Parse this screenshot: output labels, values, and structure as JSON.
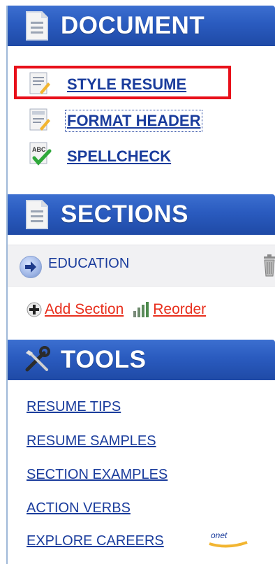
{
  "document": {
    "title": "DOCUMENT",
    "items": [
      {
        "label": "STYLE RESUME",
        "icon": "style-resume-icon"
      },
      {
        "label": "FORMAT HEADER",
        "icon": "format-header-icon"
      },
      {
        "label": "SPELLCHECK",
        "icon": "spellcheck-icon"
      }
    ]
  },
  "sections": {
    "title": "SECTIONS",
    "rows": [
      {
        "label": "EDUCATION"
      }
    ],
    "add_label": "Add Section",
    "reorder_label": "Reorder"
  },
  "tools": {
    "title": "TOOLS",
    "links": [
      "RESUME TIPS",
      "RESUME SAMPLES",
      "SECTION EXAMPLES",
      "ACTION VERBS",
      "EXPLORE CAREERS"
    ],
    "onet_badge": "onet"
  },
  "colors": {
    "header_blue": "#2a5bbf",
    "link_blue": "#1a3c9c",
    "action_red": "#e8301e",
    "highlight_red": "#e8101a"
  }
}
